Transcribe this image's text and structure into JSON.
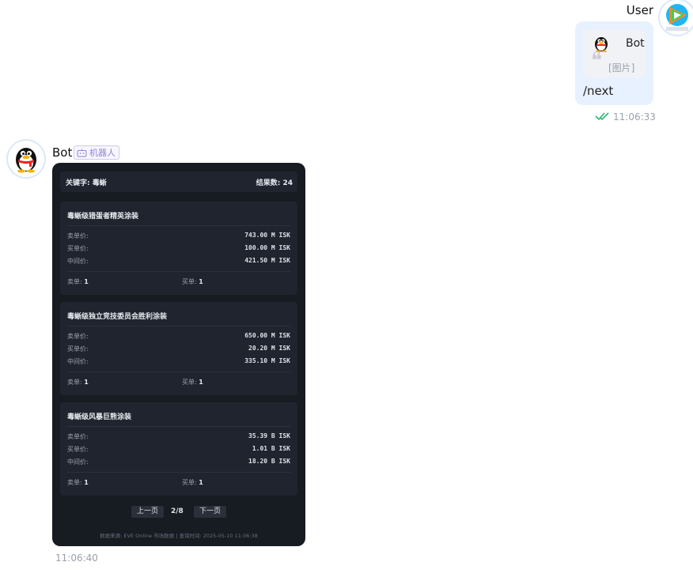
{
  "user": {
    "name": "User",
    "quote": {
      "author": "Bot",
      "content": "[图片]",
      "mark": "❝"
    },
    "text": "/next",
    "time": "11:06:33"
  },
  "bot": {
    "name": "Bot",
    "tag": "机器人",
    "time": "11:06:40",
    "card": {
      "keyword": "关键字: 毒蜥",
      "result_count": "结果数: 24",
      "items": [
        {
          "title": "毒蜥级猎蛋者精英涂装",
          "rows": [
            {
              "label": "卖单价:",
              "value": "743.00 M ISK"
            },
            {
              "label": "买单价:",
              "value": "100.00 M ISK"
            },
            {
              "label": "中间价:",
              "value": "421.50 M ISK"
            }
          ],
          "sell_label": "卖单:",
          "sell_count": "1",
          "buy_label": "买单:",
          "buy_count": "1"
        },
        {
          "title": "毒蜥级独立竞技委员会胜利涂装",
          "rows": [
            {
              "label": "卖单价:",
              "value": "650.00 M ISK"
            },
            {
              "label": "买单价:",
              "value": "20.20 M ISK"
            },
            {
              "label": "中间价:",
              "value": "335.10 M ISK"
            }
          ],
          "sell_label": "卖单:",
          "sell_count": "1",
          "buy_label": "买单:",
          "buy_count": "1"
        },
        {
          "title": "毒蜥级风暴巨熊涂装",
          "rows": [
            {
              "label": "卖单价:",
              "value": "35.39 B ISK"
            },
            {
              "label": "买单价:",
              "value": "1.01 B ISK"
            },
            {
              "label": "中间价:",
              "value": "18.20 B ISK"
            }
          ],
          "sell_label": "卖单:",
          "sell_count": "1",
          "buy_label": "买单:",
          "buy_count": "1"
        }
      ],
      "pager": {
        "prev": "上一页",
        "page": "2/8",
        "next": "下一页"
      },
      "footer": "数据来源: EVE Online 市场数据 | 查询时间: 2025-05-10 11:06:38"
    }
  },
  "icons": {
    "user_avatar": "video-play-avatar-icon",
    "bot_avatar": "penguin-avatar-icon",
    "read_status": "double-check-icon",
    "bot_tag": "robot-icon"
  },
  "colors": {
    "user_bubble": "#e8f1ff",
    "card_bg": "#171b22",
    "item_bg": "#1f242e",
    "check": "#2bb673",
    "tag": "#8f83d6"
  }
}
